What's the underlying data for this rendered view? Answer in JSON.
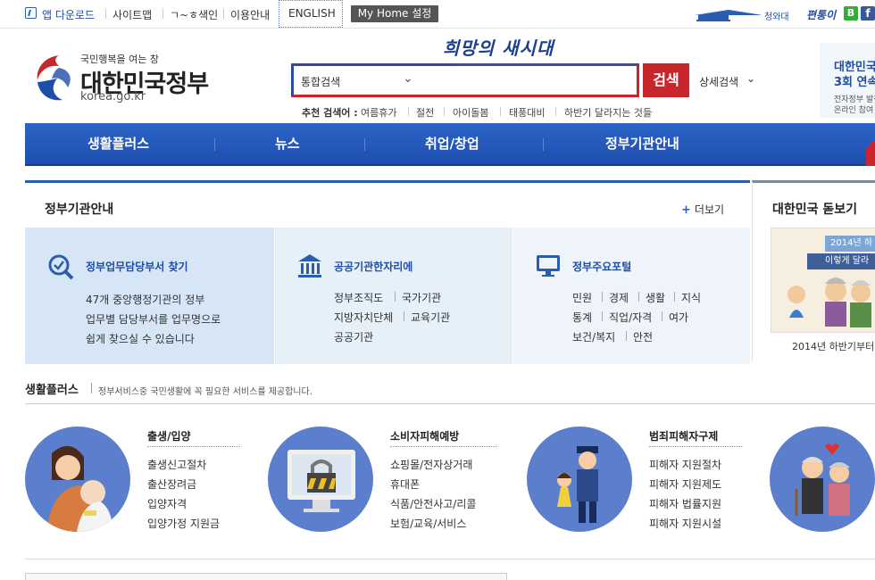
{
  "topbar": {
    "app_download": "앱 다운로드",
    "sitemap": "사이트맵",
    "index": "ㄱ~ㅎ색인",
    "usage": "이용안내",
    "english": "ENGLISH",
    "myhome": "My Home 설정",
    "bluehouse": "청와대",
    "pyeontong": "편통이",
    "sns_b": "B",
    "sns_f": "f"
  },
  "header": {
    "logo_slogan": "국민행복을 여는 창",
    "logo_title": "대한민국정부",
    "logo_url": "korea.go.kr",
    "slogan_script": "희망의 새시대",
    "search_scope": "통합검색",
    "search_button": "검색",
    "advanced_search": "상세검색",
    "recommended_label": "추천 검색어 :",
    "recommended": [
      "여름휴가",
      "절전",
      "아이돌봄",
      "태풍대비",
      "하반기 달라지는 것들"
    ],
    "side_banner": {
      "line1": "대한민국",
      "line2": "3회 연속",
      "line3": "전자정부 발전",
      "line4": "온라인 참여"
    }
  },
  "nav": {
    "items": [
      "생활플러스",
      "뉴스",
      "취업/창업",
      "정부기관안내"
    ]
  },
  "agency": {
    "title": "정부기관안내",
    "more": "더보기",
    "cards": [
      {
        "title": "정부업무담당부서 찾기",
        "lines": [
          "47개 중앙행정기관의 정부",
          "업무별 담당부서를 업무명으로",
          "쉽게 찾으실 수 있습니다"
        ]
      },
      {
        "title": "공공기관한자리에",
        "links": [
          "정부조직도",
          "국가기관",
          "지방자치단체",
          "교육기관",
          "공공기관"
        ]
      },
      {
        "title": "정부주요포털",
        "links": [
          "민원",
          "경제",
          "생활",
          "지식",
          "통계",
          "직업/자격",
          "여가",
          "보건/복지",
          "안전"
        ]
      }
    ]
  },
  "look": {
    "title": "대한민국 돋보기",
    "image_line1": "2014년 하",
    "image_line2": "이렇게 달라",
    "caption": "2014년 하반기부터"
  },
  "life": {
    "title": "생활플러스",
    "desc": "정부서비스중 국민생활에 꼭 필요한 서비스를 제공합니다.",
    "groups": [
      {
        "title": "출생/입양",
        "items": [
          "출생신고절차",
          "출산장려금",
          "입양자격",
          "입양가정 지원금"
        ]
      },
      {
        "title": "소비자피해예방",
        "items": [
          "쇼핑몰/전자상거래",
          "휴대폰",
          "식품/안전사고/리콜",
          "보험/교육/서비스"
        ]
      },
      {
        "title": "범죄피해자구제",
        "items": [
          "피해자 지원절차",
          "피해자 지원제도",
          "피해자 법률지원",
          "피해자 지원시설"
        ]
      }
    ]
  },
  "colors": {
    "nav_blue": "#2a5db0",
    "search_red": "#c8262c",
    "circle_blue": "#5b7fcd"
  }
}
